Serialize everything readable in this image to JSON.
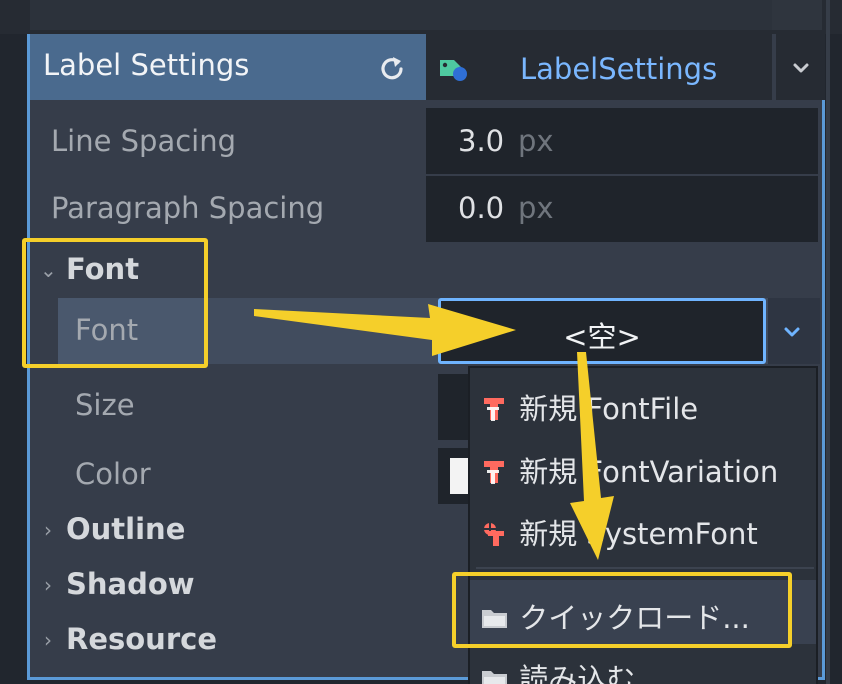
{
  "header": {
    "title": "Label Settings",
    "resource_name": "LabelSettings"
  },
  "properties": {
    "line_spacing": {
      "label": "Line Spacing",
      "value": "3.0",
      "unit": "px"
    },
    "paragraph_spacing": {
      "label": "Paragraph Spacing",
      "value": "0.0",
      "unit": "px"
    }
  },
  "font_section": {
    "title": "Font",
    "font_label": "Font",
    "font_value": "<空>",
    "size_label": "Size",
    "color_label": "Color"
  },
  "sections": {
    "outline": "Outline",
    "shadow": "Shadow",
    "resource": "Resource"
  },
  "menu": {
    "items": [
      {
        "label": "新規 FontFile",
        "icon": "font-file-icon"
      },
      {
        "label": "新規 FontVariation",
        "icon": "font-variation-icon"
      },
      {
        "label": "新規 SystemFont",
        "icon": "system-font-icon"
      },
      {
        "label": "クイックロード...",
        "icon": "folder-icon"
      },
      {
        "label": "読み込む",
        "icon": "folder-icon"
      }
    ]
  },
  "colors": {
    "accent": "#5b9ad7",
    "highlight": "#f5cf2a",
    "link": "#7ab7ff"
  }
}
